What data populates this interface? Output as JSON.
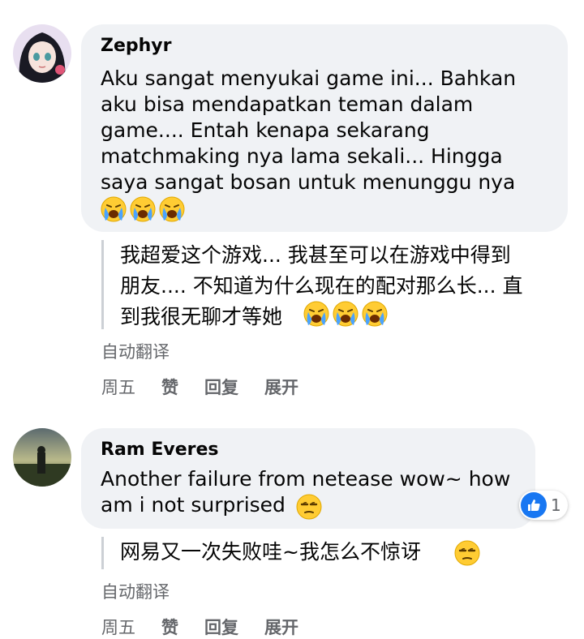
{
  "comments": [
    {
      "author": "Zephyr",
      "text": "Aku sangat menyukai game ini... Bahkan\naku bisa mendapatkan teman dalam\ngame.... Entah kenapa sekarang\nmatchmaking nya lama sekali... Hingga\nsaya sangat bosan untuk menunggu nya",
      "emoji": [
        "crying-face-emoji",
        "crying-face-emoji",
        "crying-face-emoji"
      ],
      "translation": "我超爱这个游戏... 我甚至可以在游戏中得到\n朋友.... 不知道为什么现在的配对那么长... 直\n到我很无聊才等她",
      "translation_emoji": [
        "crying-face-emoji",
        "crying-face-emoji",
        "crying-face-emoji"
      ],
      "auto_translate_label": "自动翻译",
      "time": "周五",
      "like_label": "赞",
      "reply_label": "回复",
      "expand_label": "展开"
    },
    {
      "author": "Ram Everes",
      "text": "Another failure from netease wow~ how\nam i not surprised",
      "emoji": [
        "unamused-face-emoji"
      ],
      "translation": "网易又一次失败哇~我怎么不惊讶",
      "translation_emoji": [
        "unamused-face-emoji"
      ],
      "reaction_count": "1",
      "auto_translate_label": "自动翻译",
      "time": "周五",
      "like_label": "赞",
      "reply_label": "回复",
      "expand_label": "展开"
    }
  ],
  "colors": {
    "bubble": "#f0f2f5",
    "secondary_text": "#65676b",
    "like_blue": "#1877f2"
  }
}
